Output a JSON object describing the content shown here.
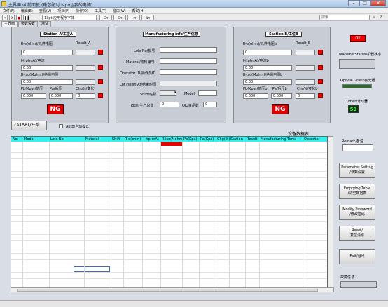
{
  "window": {
    "title": "主界面.vi 前面板 (电芯配对.lvproj/我的电脑)",
    "min": "–",
    "max": "□",
    "close": "✕"
  },
  "menu": [
    "文件(F)",
    "编辑(E)",
    "查看(V)",
    "项目(P)",
    "操作(O)",
    "工具(T)",
    "窗口(W)",
    "帮助(H)"
  ],
  "toolbar": {
    "font": "13pt 应用程序字体",
    "search_placeholder": "搜索"
  },
  "tabs": [
    "主界面",
    "参数设置",
    "测试"
  ],
  "station_a": {
    "title": "Station A/工位A",
    "r_e": "R-e(ohm)/元件电阻",
    "result": "Result_A",
    "r_e_val": "0",
    "i_hp": "I-hp(mA)/电流",
    "i_hp_val": "0.00",
    "r_iso": "R-iso(Mohm)/绝缘电阻",
    "r_iso_val": "0.00",
    "pb": "Pb(Kpa)/前压",
    "pa": "Pa/后压",
    "chg": "Chg%/变化",
    "pb_val": "0.000",
    "pa_val": "0.000",
    "chg_val": "0",
    "ng": "NG"
  },
  "station_b": {
    "title": "Station B/工位B",
    "r_e": "R-e(ohm)/元件电阻b",
    "result": "Result_B",
    "r_e_val": "0",
    "i_hp": "I-hp(mA)/电流b",
    "i_hp_val": "0.00",
    "r_iso": "R-iso(Mohm)/绝缘电阻b",
    "r_iso_val": "0.00",
    "pb": "Pb(Kpa)/前压b",
    "pa": "Pa/后压b",
    "chg": "Chg%/变化b",
    "pb_val": "0.000",
    "pa_val": "0.000",
    "chg_val": "0",
    "ng": "NG"
  },
  "info": {
    "title": "Manufacturing info/生产信息",
    "lots": "Lots No/批号",
    "material": "Materal/物料编号",
    "operator": "Operator ID/操作员ID",
    "lot_finish": "Lot Finish At/结束时间",
    "shift": "Shift/班别",
    "model": "Model",
    "total": "Total/生产总数",
    "total_val": "0",
    "ok": "OK/良品数",
    "ok_val": "0"
  },
  "start_button": "START/开始",
  "auto_mode": "Auto/自动模式",
  "table_title": "设备数据表",
  "columns": [
    "No",
    "Model",
    "Lots No",
    "Materal",
    "Shift",
    "R-e(ohm)",
    "I-hp(mA)",
    "R-iso(Mohm)",
    "Pb(Kpa)",
    "Pa(Kpa)",
    "Chg(%)",
    "Station",
    "Result",
    "Manufacturing Time",
    "Operator"
  ],
  "right": {
    "remark": "Remark/备注",
    "machine_status": "Machine Status/机器状态",
    "optical_grating": "Optical Grating/光栅",
    "timer": "Timer/计时器",
    "timer_val": "59",
    "red_btn": "OK",
    "status_info": "故障信息"
  },
  "buttons": {
    "param_1": "Parameter Setting",
    "param_2": "/参数设置",
    "empty_1": "Emptying Table",
    "empty_2": "/清空数据表",
    "pwd_1": "Modify Password",
    "pwd_2": "/修改密码",
    "reset_1": "Reset/",
    "reset_2": "复位清零",
    "exit_1": "Exit/退出"
  }
}
